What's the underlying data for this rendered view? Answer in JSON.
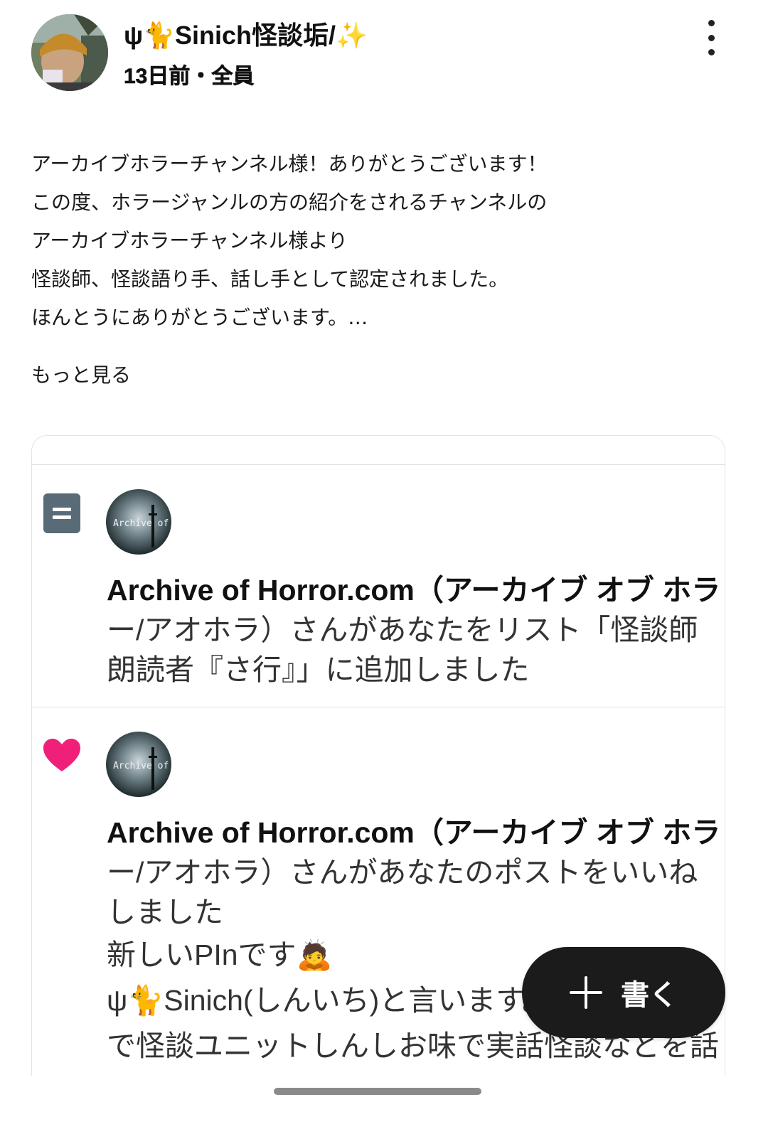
{
  "post": {
    "author_name": "ψ🐈Sinich怪談垢/",
    "author_spark": "✨",
    "meta": "13日前・全員",
    "body_lines": [
      "アーカイブホラーチャンネル様！ありがとうございます！",
      "この度、ホラージャンルの方の紹介をされるチャンネルの",
      "アーカイブホラーチャンネル様より",
      "怪談師、怪談語り手、話し手として認定されました。",
      "ほんとうにありがとうございます。…"
    ],
    "see_more": "もっと見る"
  },
  "embed": {
    "notifications": [
      {
        "type": "list-add",
        "icon": "list-icon",
        "avatar_text": "Archive of Horror",
        "lines": [
          "Archive of Horror.com（アーカイブ オブ ホラ",
          "ー/アオホラ）さんがあなたをリスト「怪談師",
          "朗読者『さ行』」に追加しました"
        ]
      },
      {
        "type": "like",
        "icon": "heart-icon",
        "avatar_text": "Archive of Horror",
        "lines": [
          "Archive of Horror.com（アーカイブ オブ ホラ",
          "ー/アオホラ）さんがあなたのポストをいいね",
          "しました"
        ],
        "quote_lines": [
          "新しいPInです🙇",
          "ψ🐈Sinich(しんいち)と言います。",
          "で怪談ユニットしんしお味で実話怪談などを話"
        ]
      }
    ]
  },
  "compose": {
    "label": "書く"
  },
  "colors": {
    "heart": "#f0207a",
    "list_icon": "#5a6b78",
    "fab_bg": "#1b1b1b"
  }
}
